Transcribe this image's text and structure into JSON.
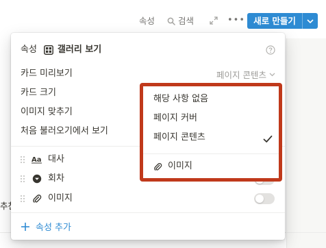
{
  "toolbar": {
    "properties_label": "속성",
    "search_label": "검색",
    "more_label": "•••",
    "new_button_label": "새로 만들기"
  },
  "background": {
    "left_text": "추천"
  },
  "panel": {
    "tab_label": "속성",
    "view_label": "갤러리 보기",
    "settings": [
      {
        "label": "카드 미리보기",
        "value": "페이지 콘텐츠"
      },
      {
        "label": "카드 크기"
      },
      {
        "label": "이미지 맞추기"
      },
      {
        "label": "처음 불러오기에서 보기"
      }
    ],
    "properties": [
      {
        "icon": "text-type-icon",
        "label": "대사"
      },
      {
        "icon": "select-type-icon",
        "label": "회차"
      },
      {
        "icon": "attachment-icon",
        "label": "이미지"
      }
    ],
    "add_property_label": "속성 추가"
  },
  "dropdown": {
    "options": [
      "해당 사항 없음",
      "페이지 커버",
      "페이지 콘텐츠"
    ],
    "selected": "페이지 콘텐츠",
    "image_option": "이미지",
    "highlight_color": "#c0391b"
  },
  "colors": {
    "accent": "#2e8bd3",
    "text": "#37352f",
    "muted": "#9b9a97"
  }
}
